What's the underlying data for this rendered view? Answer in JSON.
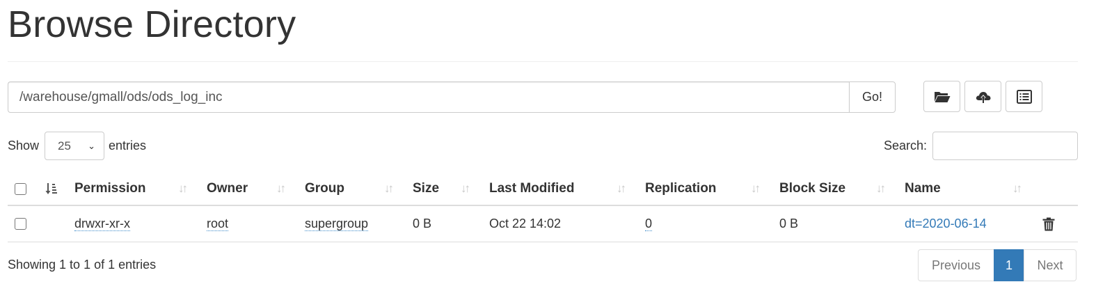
{
  "page": {
    "title": "Browse Directory"
  },
  "path_bar": {
    "value": "/warehouse/gmall/ods/ods_log_inc",
    "go_label": "Go!"
  },
  "toolbar": {
    "icons": [
      "folder-open-icon",
      "cloud-upload-icon",
      "list-alt-icon"
    ]
  },
  "entries_control": {
    "show_label": "Show",
    "selected": "25",
    "suffix_label": "entries"
  },
  "search": {
    "label": "Search:",
    "value": ""
  },
  "table": {
    "columns": [
      "Permission",
      "Owner",
      "Group",
      "Size",
      "Last Modified",
      "Replication",
      "Block Size",
      "Name"
    ],
    "rows": [
      {
        "permission": "drwxr-xr-x",
        "owner": "root",
        "group": "supergroup",
        "size": "0 B",
        "last_modified": "Oct 22 14:02",
        "replication": "0",
        "block_size": "0 B",
        "name": "dt=2020-06-14"
      }
    ]
  },
  "info": {
    "text": "Showing 1 to 1 of 1 entries"
  },
  "pagination": {
    "previous": "Previous",
    "current": "1",
    "next": "Next"
  },
  "colors": {
    "accent": "#337ab7",
    "border": "#dddddd",
    "text": "#333333"
  }
}
